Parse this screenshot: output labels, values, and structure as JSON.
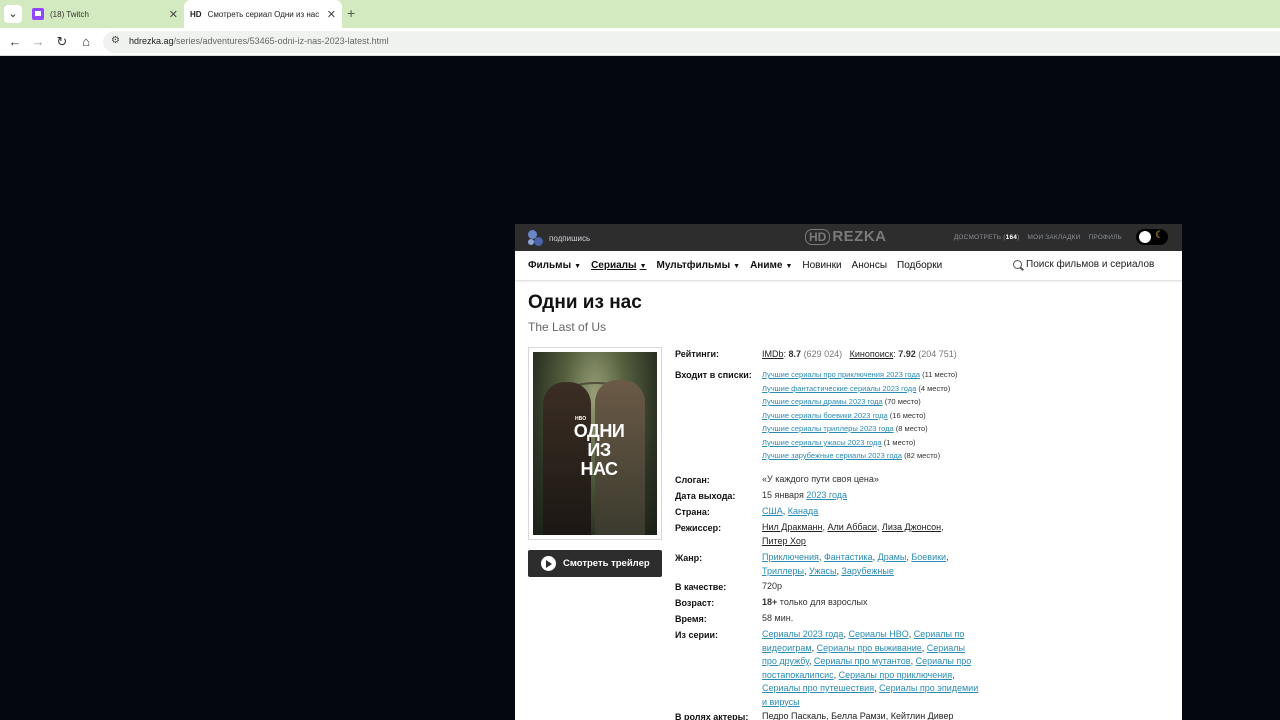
{
  "browser": {
    "tabs": [
      {
        "title": "(18) Twitch",
        "active": false,
        "favicon": "twitch-icon"
      },
      {
        "title": "Смотреть сериал Одни из нас",
        "active": true,
        "favicon": "HD"
      }
    ],
    "address": {
      "domain": "hdrezka.ag",
      "path": "/series/adventures/53465-odni-iz-nas-2023-latest.html"
    }
  },
  "site": {
    "subscribe_label": "подпишись",
    "logo": {
      "hd": "HD",
      "name": "REZKA"
    },
    "toplinks": {
      "continue": "ДОСМОТРЕТЬ (",
      "continue_count": "164",
      "continue_close": ")",
      "bookmarks": "МОИ ЗАКЛАДКИ",
      "profile": "ПРОФИЛЬ"
    },
    "nav": [
      {
        "label": "Фильмы",
        "dropdown": true,
        "bold": true
      },
      {
        "label": "Сериалы",
        "dropdown": true,
        "bold": true,
        "active": true
      },
      {
        "label": "Мультфильмы",
        "dropdown": true,
        "bold": true
      },
      {
        "label": "Аниме",
        "dropdown": true,
        "bold": true
      },
      {
        "label": "Новинки"
      },
      {
        "label": "Анонсы"
      },
      {
        "label": "Подборки"
      }
    ],
    "search_placeholder": "Поиск фильмов и сериалов",
    "title": "Одни из нас",
    "original_title": "The Last of Us",
    "poster": {
      "brand": "HBO",
      "title_lines": [
        "ОДНИ",
        "ИЗ",
        "НАС"
      ]
    },
    "trailer_button": "Смотреть трейлер",
    "info": {
      "ratings_label": "Рейтинги:",
      "imdb_name": "IMDb",
      "imdb_score": "8.7",
      "imdb_votes": "(629 024)",
      "kp_name": "Кинопоиск",
      "kp_score": "7.92",
      "kp_votes": "(204 751)",
      "lists_label": "Входит в списки:",
      "lists": [
        {
          "name": "Лучшие сериалы про приключения 2023 года",
          "place": "(11 место)"
        },
        {
          "name": "Лучшие фантастические сериалы 2023 года",
          "place": "(4 место)"
        },
        {
          "name": "Лучшие сериалы драмы 2023 года",
          "place": "(70 место)"
        },
        {
          "name": "Лучшие сериалы боевики 2023 года",
          "place": "(16 место)"
        },
        {
          "name": "Лучшие сериалы триллеры 2023 года",
          "place": "(8 место)"
        },
        {
          "name": "Лучшие сериалы ужасы 2023 года",
          "place": "(1 место)"
        },
        {
          "name": "Лучшие зарубежные сериалы 2023 года",
          "place": "(82 место)"
        }
      ],
      "slogan_label": "Слоган:",
      "slogan": "«У каждого пути своя цена»",
      "release_label": "Дата выхода:",
      "release_day": "15 января",
      "release_year": "2023 года",
      "country_label": "Страна:",
      "countries": [
        "США",
        "Канада"
      ],
      "director_label": "Режиссер:",
      "directors": [
        "Нил Дракманн",
        "Али Аббаси",
        "Лиза Джонсон",
        "Питер Хор"
      ],
      "genre_label": "Жанр:",
      "genres": [
        "Приключения",
        "Фантастика",
        "Драмы",
        "Боевики",
        "Триллеры",
        "Ужасы",
        "Зарубежные"
      ],
      "quality_label": "В качестве:",
      "quality": "720p",
      "age_label": "Возраст:",
      "age": "18+",
      "age_note": "только для взрослых",
      "time_label": "Время:",
      "time": "58 мин.",
      "series_label": "Из серии:",
      "series": [
        "Сериалы 2023 года",
        "Сериалы HBO",
        "Сериалы по видеоиграм",
        "Сериалы про выживание",
        "Сериалы про дружбу",
        "Сериалы про мутантов",
        "Сериалы про постапокалипсис",
        "Сериалы про приключения",
        "Сериалы про путешествия",
        "Сериалы про эпидемии и вирусы"
      ],
      "actors_label": "В ролях актеры:",
      "actors": [
        "Педро Паскаль",
        "Белла Рамзи",
        "Кейтлин Дивер"
      ]
    }
  }
}
